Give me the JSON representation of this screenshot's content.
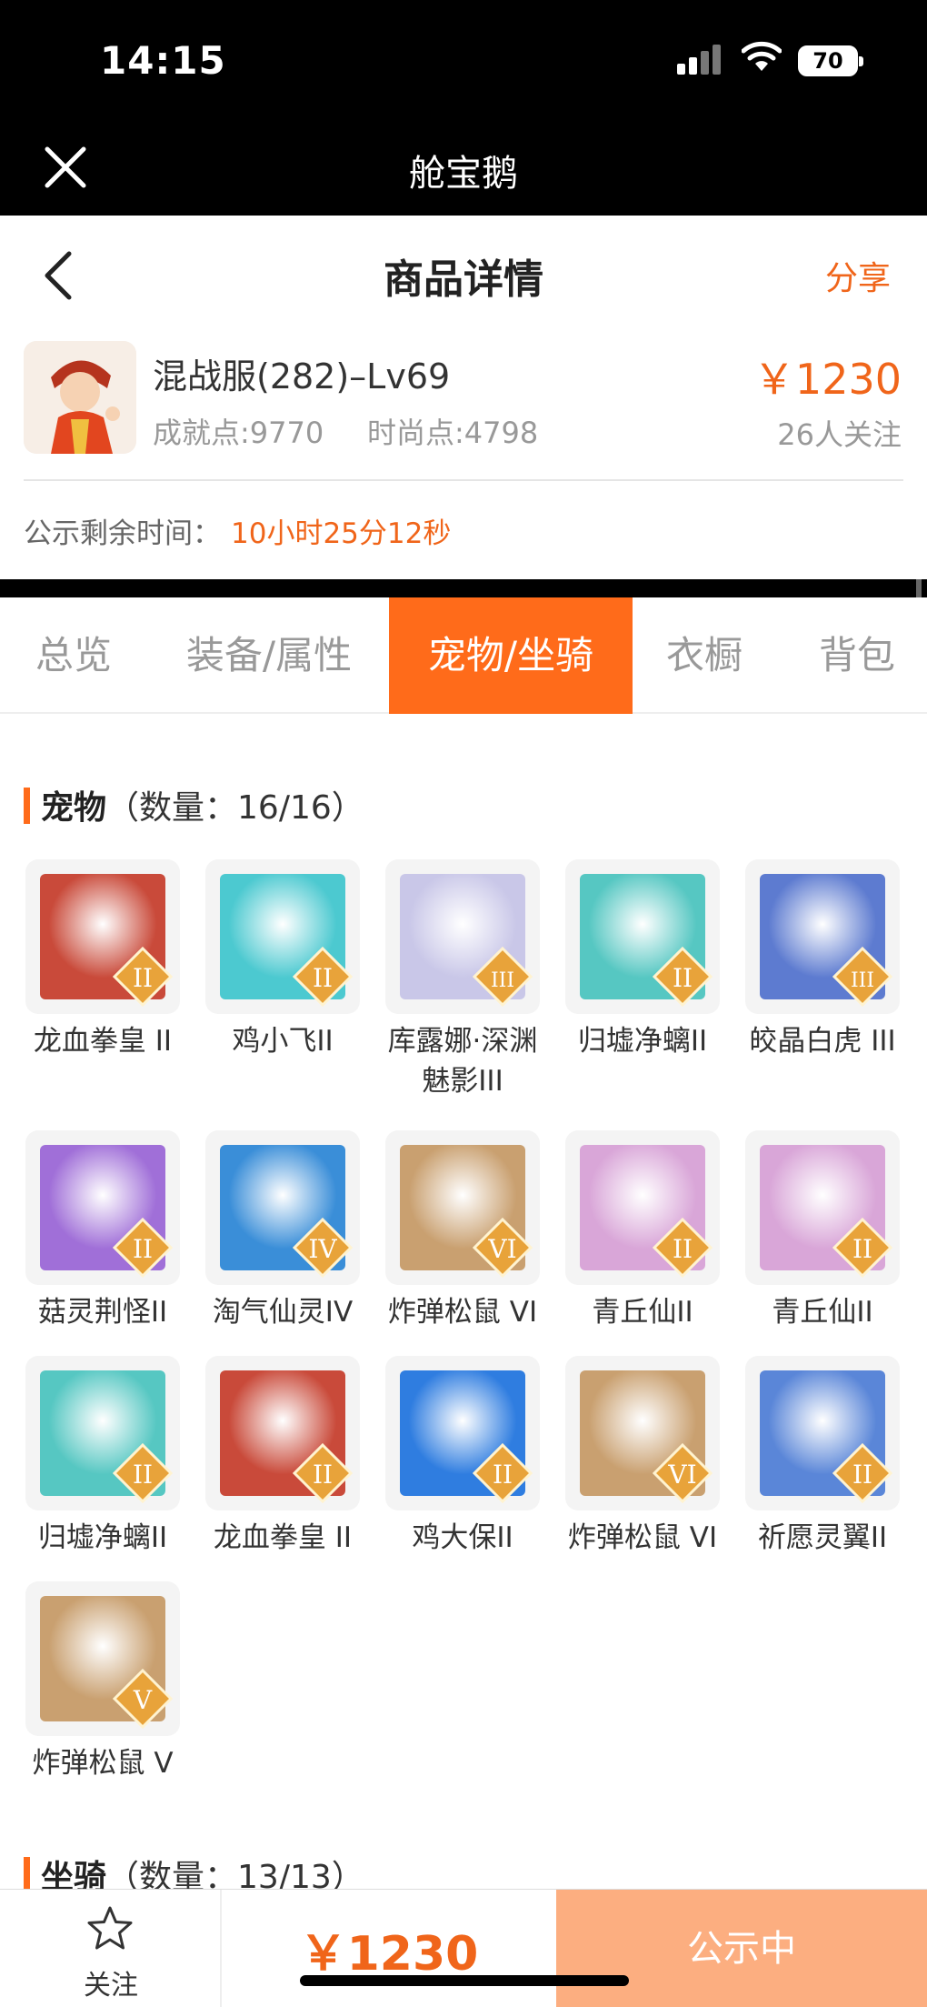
{
  "status_bar": {
    "time": "14:15",
    "battery": "70"
  },
  "app_bar": {
    "title": "舱宝鹅"
  },
  "nav": {
    "title": "商品详情",
    "share": "分享"
  },
  "product": {
    "name": "混战服(282)–Lv69",
    "achievement": "成就点:9770",
    "fashion": "时尚点:4798",
    "price": "￥1230",
    "follows": "26人关注",
    "remain_label": "公示剩余时间：",
    "remain_value": "10小时25分12秒"
  },
  "tabs": [
    {
      "label": "总览",
      "active": false
    },
    {
      "label": "装备/属性",
      "active": false
    },
    {
      "label": "宠物/坐骑",
      "active": true
    },
    {
      "label": "衣橱",
      "active": false
    },
    {
      "label": "背包",
      "active": false
    }
  ],
  "pets_section": {
    "title": "宠物",
    "count": "（数量：16/16）"
  },
  "pets": [
    {
      "name": "龙血拳皇 II",
      "grade": "II",
      "color": "#c94a3a"
    },
    {
      "name": "鸡小飞II",
      "grade": "II",
      "color": "#4cc9d0"
    },
    {
      "name": "库露娜·深渊魅影III",
      "grade": "III",
      "color": "#c9c7e8"
    },
    {
      "name": "归墟净螭II",
      "grade": "II",
      "color": "#56c7c2"
    },
    {
      "name": "皎晶白虎 III",
      "grade": "III",
      "color": "#5d7bd0"
    },
    {
      "name": "菇灵荆怪II",
      "grade": "II",
      "color": "#a06fd8"
    },
    {
      "name": "淘气仙灵IV",
      "grade": "IV",
      "color": "#3a8ed8"
    },
    {
      "name": "炸弹松鼠 VI",
      "grade": "VI",
      "color": "#c9a070"
    },
    {
      "name": "青丘仙II",
      "grade": "II",
      "color": "#d9a6d8"
    },
    {
      "name": "青丘仙II",
      "grade": "II",
      "color": "#d9a6d8"
    },
    {
      "name": "归墟净螭II",
      "grade": "II",
      "color": "#56c7c2"
    },
    {
      "name": "龙血拳皇 II",
      "grade": "II",
      "color": "#c94a3a"
    },
    {
      "name": "鸡大保II",
      "grade": "II",
      "color": "#2f7de0"
    },
    {
      "name": "炸弹松鼠 VI",
      "grade": "VI",
      "color": "#c9a070"
    },
    {
      "name": "祈愿灵翼II",
      "grade": "II",
      "color": "#5a86d8"
    },
    {
      "name": "炸弹松鼠 V",
      "grade": "V",
      "color": "#c9a070"
    }
  ],
  "mounts_section": {
    "title": "坐骑",
    "count": "（数量：13/13）"
  },
  "bottom": {
    "follow": "关注",
    "price": "￥1230",
    "status": "公示中"
  },
  "colors": {
    "accent": "#ff6b1a",
    "price": "#f0651a",
    "status_btn": "#fcae80"
  }
}
